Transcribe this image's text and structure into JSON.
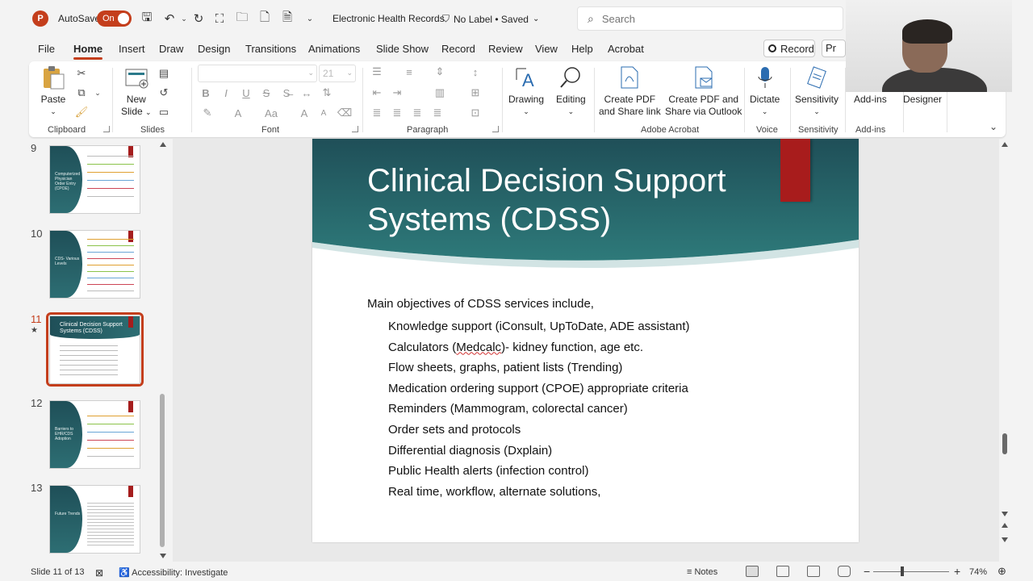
{
  "titlebar": {
    "app_logo": "P",
    "autosave_label": "AutoSave",
    "autosave_state": "On",
    "doc_title": "Electronic Health Records",
    "label_status": "No Label • Saved",
    "search_placeholder": "Search",
    "accent_color": "#c43e1c"
  },
  "tabs": [
    "File",
    "Home",
    "Insert",
    "Draw",
    "Design",
    "Transitions",
    "Animations",
    "Slide Show",
    "Record",
    "Review",
    "View",
    "Help",
    "Acrobat"
  ],
  "active_tab": "Home",
  "record_button": "Record",
  "present_button": "Pr",
  "ribbon": {
    "clipboard": {
      "paste": "Paste",
      "group": "Clipboard"
    },
    "slides": {
      "new_slide_line1": "New",
      "new_slide_line2": "Slide",
      "group": "Slides"
    },
    "font": {
      "size": "21",
      "bold": "B",
      "italic": "I",
      "underline": "U",
      "strike": "S",
      "aa": "Aa",
      "grow": "A",
      "shrink": "A",
      "group": "Font"
    },
    "paragraph": {
      "group": "Paragraph"
    },
    "drawing": "Drawing",
    "editing": "Editing",
    "acrobat": {
      "create_pdf_share_l1": "Create PDF",
      "create_pdf_share_l2": "and Share link",
      "create_pdf_outlook_l1": "Create PDF and",
      "create_pdf_outlook_l2": "Share via Outlook",
      "group": "Adobe Acrobat"
    },
    "voice": {
      "dictate": "Dictate",
      "group": "Voice"
    },
    "sensitivity": {
      "label": "Sensitivity",
      "group": "Sensitivity"
    },
    "addins": {
      "label": "Add-ins",
      "group": "Add-ins"
    },
    "designer": "Designer"
  },
  "thumbnails": [
    {
      "num": "9",
      "title": "Computerized Physician Order Entry (CPOE)"
    },
    {
      "num": "10",
      "title": "CDS- Various Levels"
    },
    {
      "num": "11",
      "title": "Clinical Decision Support Systems (CDSS)",
      "star": "★"
    },
    {
      "num": "12",
      "title": "Barriers to EHR/CDS Adoption"
    },
    {
      "num": "13",
      "title": "Future Trends"
    }
  ],
  "slide": {
    "title": "Clinical Decision Support Systems (CDSS)",
    "intro": "Main objectives of CDSS services include,",
    "bullets": [
      "Knowledge support (iConsult, UpToDate, ADE assistant)",
      "Calculators (Medcalc)- kidney function, age etc.",
      "Flow sheets, graphs, patient lists (Trending)",
      "Medication ordering support (CPOE) appropriate criteria",
      "Reminders (Mammogram, colorectal cancer)",
      "Order sets and protocols",
      "Differential diagnosis (Dxplain)",
      "Public Health alerts (infection control)",
      "Real time, workflow, alternate solutions,"
    ],
    "header_color": "#1f4f58",
    "accent_color": "#a81c1c"
  },
  "statusbar": {
    "slide_indicator": "Slide 11 of 13",
    "accessibility": "Accessibility: Investigate",
    "notes": "Notes",
    "zoom_minus": "−",
    "zoom_plus": "+",
    "zoom": "74%"
  }
}
